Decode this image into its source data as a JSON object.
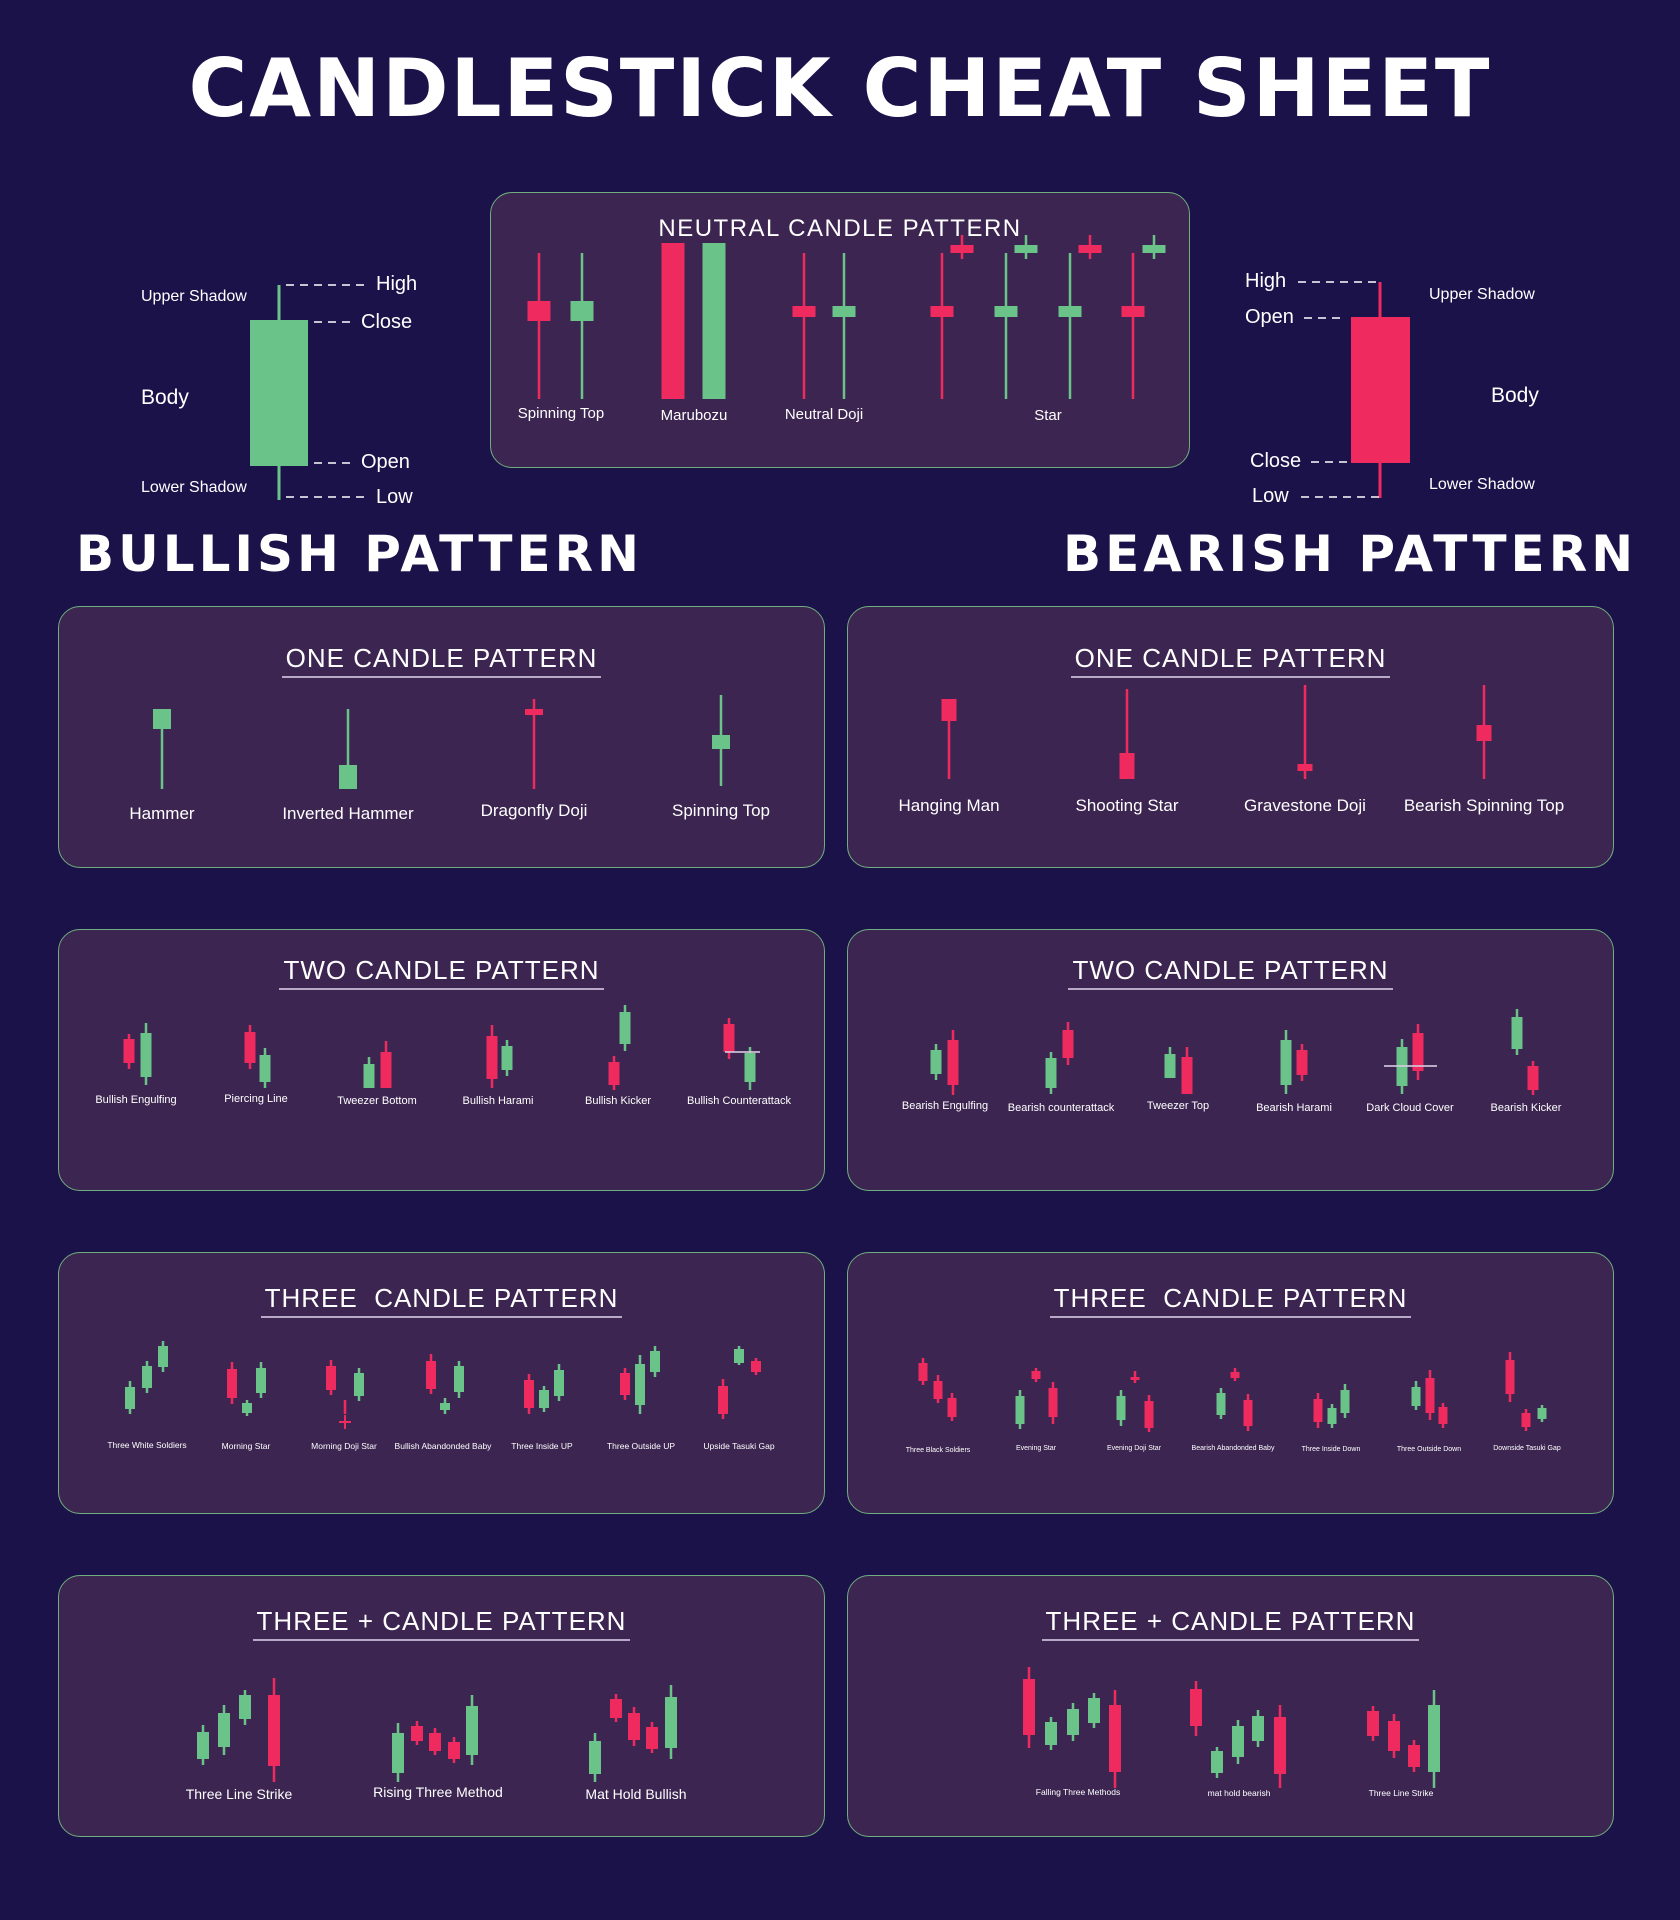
{
  "title": "CANDLESTICK CHEAT SHEET",
  "colors": {
    "background": "#1b1249",
    "panel": "#3c2550",
    "panel_border": "#6fae7e",
    "bull": "#6ac48a",
    "bear": "#ee2a5e",
    "text": "#ffffff"
  },
  "bullish_anatomy": {
    "labels": {
      "upper_shadow": "Upper Shadow",
      "body": "Body",
      "lower_shadow": "Lower Shadow",
      "high": "High",
      "close": "Close",
      "open": "Open",
      "low": "Low"
    }
  },
  "bearish_anatomy": {
    "labels": {
      "upper_shadow": "Upper Shadow",
      "body": "Body",
      "lower_shadow": "Lower Shadow",
      "high": "High",
      "open": "Open",
      "close": "Close",
      "low": "Low"
    }
  },
  "neutral": {
    "title": "NEUTRAL CANDLE PATTERN",
    "patterns": [
      "Spinning Top",
      "Marubozu",
      "Neutral Doji",
      "Star"
    ]
  },
  "sections": {
    "bullish": "BULLISH PATTERN",
    "bearish": "BEARISH PATTERN"
  },
  "panels": {
    "bull_one": {
      "title": "ONE CANDLE PATTERN",
      "patterns": [
        "Hammer",
        "Inverted Hammer",
        "Dragonfly Doji",
        "Spinning Top"
      ]
    },
    "bear_one": {
      "title": "ONE CANDLE PATTERN",
      "patterns": [
        "Hanging Man",
        "Shooting Star",
        "Gravestone Doji",
        "Bearish Spinning Top"
      ]
    },
    "bull_two": {
      "title": "TWO CANDLE PATTERN",
      "patterns": [
        "Bullish Engulfing",
        "Piercing Line",
        "Tweezer Bottom",
        "Bullish Harami",
        "Bullish Kicker",
        "Bullish Counterattack"
      ]
    },
    "bear_two": {
      "title": "TWO CANDLE PATTERN",
      "patterns": [
        "Bearish Engulfing",
        "Bearish counterattack",
        "Tweezer Top",
        "Bearish Harami",
        "Dark Cloud Cover",
        "Bearish Kicker"
      ]
    },
    "bull_three": {
      "title": "THREE  CANDLE PATTERN",
      "patterns": [
        "Three White Soldiers",
        "Morning Star",
        "Morning Doji Star",
        "Bullish Abandonded Baby",
        "Three Inside UP",
        "Three Outside UP",
        "Upside Tasuki Gap"
      ]
    },
    "bear_three": {
      "title": "THREE  CANDLE PATTERN",
      "patterns": [
        "Three Black Soldiers",
        "Evening Star",
        "Evening Doji Star",
        "Bearish Abandonded Baby",
        "Three Inside Down",
        "Three Outside Down",
        "Downside Tasuki Gap"
      ]
    },
    "bull_plus": {
      "title": "THREE + CANDLE PATTERN",
      "patterns": [
        "Three Line Strike",
        "Rising Three Method",
        "Mat Hold Bullish"
      ]
    },
    "bear_plus": {
      "title": "THREE + CANDLE PATTERN",
      "patterns": [
        "Falling Three Methods",
        "mat hold bearish",
        "Three Line Strike"
      ]
    }
  }
}
